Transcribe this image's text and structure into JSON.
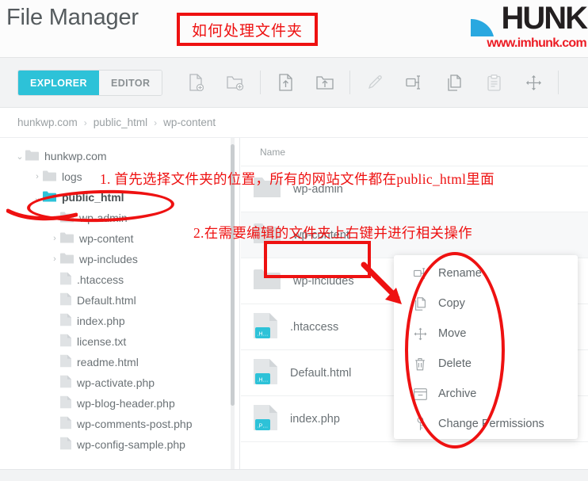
{
  "header": {
    "title": "File Manager",
    "logo_text": "HUNK",
    "logo_url": "www.imhunk.com",
    "annotation_box": "如何处理文件夹"
  },
  "toolbar": {
    "tabs": [
      {
        "label": "EXPLORER",
        "active": true
      },
      {
        "label": "EDITOR",
        "active": false
      }
    ],
    "buttons": [
      {
        "name": "new-file-icon",
        "label": "New File"
      },
      {
        "name": "new-folder-icon",
        "label": "New Folder"
      },
      {
        "name": "upload-file-icon",
        "label": "Upload File"
      },
      {
        "name": "upload-folder-icon",
        "label": "Upload Folder"
      },
      {
        "name": "edit-pencil-icon",
        "label": "Edit"
      },
      {
        "name": "rename-icon",
        "label": "Rename"
      },
      {
        "name": "copy-icon",
        "label": "Copy"
      },
      {
        "name": "paste-clipboard-icon",
        "label": "Paste"
      },
      {
        "name": "move-icon",
        "label": "Move"
      }
    ]
  },
  "breadcrumb": {
    "items": [
      "hunkwp.com",
      "public_html",
      "wp-content"
    ],
    "separator": "›"
  },
  "tree": {
    "items": [
      {
        "label": "hunkwp.com",
        "depth": 0,
        "type": "folder",
        "caret": "⌄",
        "selected": false
      },
      {
        "label": "logs",
        "depth": 1,
        "type": "folder",
        "caret": "›",
        "selected": false
      },
      {
        "label": "public_html",
        "depth": 1,
        "type": "folder",
        "caret": "⌄",
        "selected": true
      },
      {
        "label": "wp-admin",
        "depth": 2,
        "type": "folder",
        "caret": "›",
        "selected": false
      },
      {
        "label": "wp-content",
        "depth": 2,
        "type": "folder",
        "caret": "›",
        "selected": false
      },
      {
        "label": "wp-includes",
        "depth": 2,
        "type": "folder",
        "caret": "›",
        "selected": false
      },
      {
        "label": ".htaccess",
        "depth": 2,
        "type": "file",
        "caret": "",
        "selected": false
      },
      {
        "label": "Default.html",
        "depth": 2,
        "type": "file",
        "caret": "",
        "selected": false
      },
      {
        "label": "index.php",
        "depth": 2,
        "type": "file",
        "caret": "",
        "selected": false
      },
      {
        "label": "license.txt",
        "depth": 2,
        "type": "file",
        "caret": "",
        "selected": false
      },
      {
        "label": "readme.html",
        "depth": 2,
        "type": "file",
        "caret": "",
        "selected": false
      },
      {
        "label": "wp-activate.php",
        "depth": 2,
        "type": "file",
        "caret": "",
        "selected": false
      },
      {
        "label": "wp-blog-header.php",
        "depth": 2,
        "type": "file",
        "caret": "",
        "selected": false
      },
      {
        "label": "wp-comments-post.php",
        "depth": 2,
        "type": "file",
        "caret": "",
        "selected": false
      },
      {
        "label": "wp-config-sample.php",
        "depth": 2,
        "type": "file",
        "caret": "",
        "selected": false
      }
    ]
  },
  "filelist": {
    "column_header": "Name",
    "rows": [
      {
        "label": "wp-admin",
        "type": "folder",
        "badge": "",
        "alt": false
      },
      {
        "label": "wp-content",
        "type": "folder",
        "badge": "",
        "alt": true
      },
      {
        "label": "wp-includes",
        "type": "folder",
        "badge": "",
        "alt": false
      },
      {
        "label": ".htaccess",
        "type": "file",
        "badge": ".H…",
        "alt": false
      },
      {
        "label": "Default.html",
        "type": "file",
        "badge": ".H…",
        "alt": false
      },
      {
        "label": "index.php",
        "type": "file",
        "badge": ".P…",
        "alt": false
      }
    ]
  },
  "context_menu": {
    "items": [
      {
        "label": "Rename",
        "icon": "rename-icon"
      },
      {
        "label": "Copy",
        "icon": "copy-icon"
      },
      {
        "label": "Move",
        "icon": "move-icon"
      },
      {
        "label": "Delete",
        "icon": "trash-icon"
      },
      {
        "label": "Archive",
        "icon": "archive-icon"
      },
      {
        "label": "Change Permissions",
        "icon": "key-icon"
      }
    ]
  },
  "annotations": {
    "line1": "1. 首先选择文件夹的位置，所有的网站文件都在public_html里面",
    "line2": "2.在需要编辑的文件夹上右键并进行相关操作"
  },
  "colors": {
    "accent": "#2dc2d8",
    "annotation_red": "#ee1111",
    "logo_red": "#ec1c24",
    "text": "#6b7276",
    "muted": "#9aa0a3",
    "toolbar_bg": "#f2f3f4"
  }
}
